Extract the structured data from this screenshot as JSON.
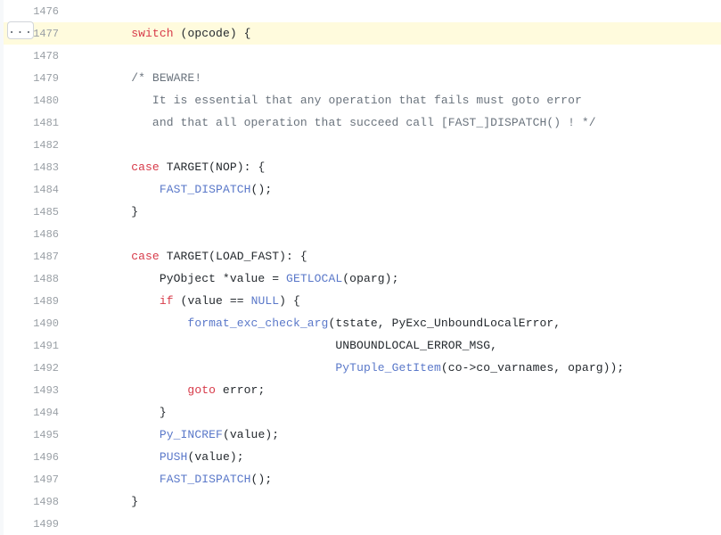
{
  "more_button_label": "...",
  "lines": [
    {
      "num": "1476",
      "highlighted": false,
      "tokens": []
    },
    {
      "num": "1477",
      "highlighted": true,
      "tokens": [
        {
          "t": "        ",
          "c": "plain"
        },
        {
          "t": "switch",
          "c": "k"
        },
        {
          "t": " (opcode) {",
          "c": "plain"
        }
      ]
    },
    {
      "num": "1478",
      "highlighted": false,
      "tokens": []
    },
    {
      "num": "1479",
      "highlighted": false,
      "tokens": [
        {
          "t": "        ",
          "c": "plain"
        },
        {
          "t": "/* BEWARE!",
          "c": "cmt"
        }
      ]
    },
    {
      "num": "1480",
      "highlighted": false,
      "tokens": [
        {
          "t": "           It is essential that any operation that fails must goto error",
          "c": "cmt"
        }
      ]
    },
    {
      "num": "1481",
      "highlighted": false,
      "tokens": [
        {
          "t": "           and that all operation that succeed call [FAST_]DISPATCH() ! */",
          "c": "cmt"
        }
      ]
    },
    {
      "num": "1482",
      "highlighted": false,
      "tokens": []
    },
    {
      "num": "1483",
      "highlighted": false,
      "tokens": [
        {
          "t": "        ",
          "c": "plain"
        },
        {
          "t": "case",
          "c": "k"
        },
        {
          "t": " TARGET(NOP): {",
          "c": "plain"
        }
      ]
    },
    {
      "num": "1484",
      "highlighted": false,
      "tokens": [
        {
          "t": "            ",
          "c": "plain"
        },
        {
          "t": "FAST_DISPATCH",
          "c": "fn"
        },
        {
          "t": "();",
          "c": "plain"
        }
      ]
    },
    {
      "num": "1485",
      "highlighted": false,
      "tokens": [
        {
          "t": "        }",
          "c": "plain"
        }
      ]
    },
    {
      "num": "1486",
      "highlighted": false,
      "tokens": []
    },
    {
      "num": "1487",
      "highlighted": false,
      "tokens": [
        {
          "t": "        ",
          "c": "plain"
        },
        {
          "t": "case",
          "c": "k"
        },
        {
          "t": " TARGET(LOAD_FAST): {",
          "c": "plain"
        }
      ]
    },
    {
      "num": "1488",
      "highlighted": false,
      "tokens": [
        {
          "t": "            PyObject *value = ",
          "c": "plain"
        },
        {
          "t": "GETLOCAL",
          "c": "fn"
        },
        {
          "t": "(oparg);",
          "c": "plain"
        }
      ]
    },
    {
      "num": "1489",
      "highlighted": false,
      "tokens": [
        {
          "t": "            ",
          "c": "plain"
        },
        {
          "t": "if",
          "c": "k"
        },
        {
          "t": " (value == ",
          "c": "plain"
        },
        {
          "t": "NULL",
          "c": "const"
        },
        {
          "t": ") {",
          "c": "plain"
        }
      ]
    },
    {
      "num": "1490",
      "highlighted": false,
      "tokens": [
        {
          "t": "                ",
          "c": "plain"
        },
        {
          "t": "format_exc_check_arg",
          "c": "fn"
        },
        {
          "t": "(tstate, PyExc_UnboundLocalError,",
          "c": "plain"
        }
      ]
    },
    {
      "num": "1491",
      "highlighted": false,
      "tokens": [
        {
          "t": "                                     UNBOUNDLOCAL_ERROR_MSG,",
          "c": "plain"
        }
      ]
    },
    {
      "num": "1492",
      "highlighted": false,
      "tokens": [
        {
          "t": "                                     ",
          "c": "plain"
        },
        {
          "t": "PyTuple_GetItem",
          "c": "fn"
        },
        {
          "t": "(co->co_varnames, oparg));",
          "c": "plain"
        }
      ]
    },
    {
      "num": "1493",
      "highlighted": false,
      "tokens": [
        {
          "t": "                ",
          "c": "plain"
        },
        {
          "t": "goto",
          "c": "k"
        },
        {
          "t": " error;",
          "c": "plain"
        }
      ]
    },
    {
      "num": "1494",
      "highlighted": false,
      "tokens": [
        {
          "t": "            }",
          "c": "plain"
        }
      ]
    },
    {
      "num": "1495",
      "highlighted": false,
      "tokens": [
        {
          "t": "            ",
          "c": "plain"
        },
        {
          "t": "Py_INCREF",
          "c": "fn"
        },
        {
          "t": "(value);",
          "c": "plain"
        }
      ]
    },
    {
      "num": "1496",
      "highlighted": false,
      "tokens": [
        {
          "t": "            ",
          "c": "plain"
        },
        {
          "t": "PUSH",
          "c": "fn"
        },
        {
          "t": "(value);",
          "c": "plain"
        }
      ]
    },
    {
      "num": "1497",
      "highlighted": false,
      "tokens": [
        {
          "t": "            ",
          "c": "plain"
        },
        {
          "t": "FAST_DISPATCH",
          "c": "fn"
        },
        {
          "t": "();",
          "c": "plain"
        }
      ]
    },
    {
      "num": "1498",
      "highlighted": false,
      "tokens": [
        {
          "t": "        }",
          "c": "plain"
        }
      ]
    },
    {
      "num": "1499",
      "highlighted": false,
      "tokens": []
    }
  ]
}
